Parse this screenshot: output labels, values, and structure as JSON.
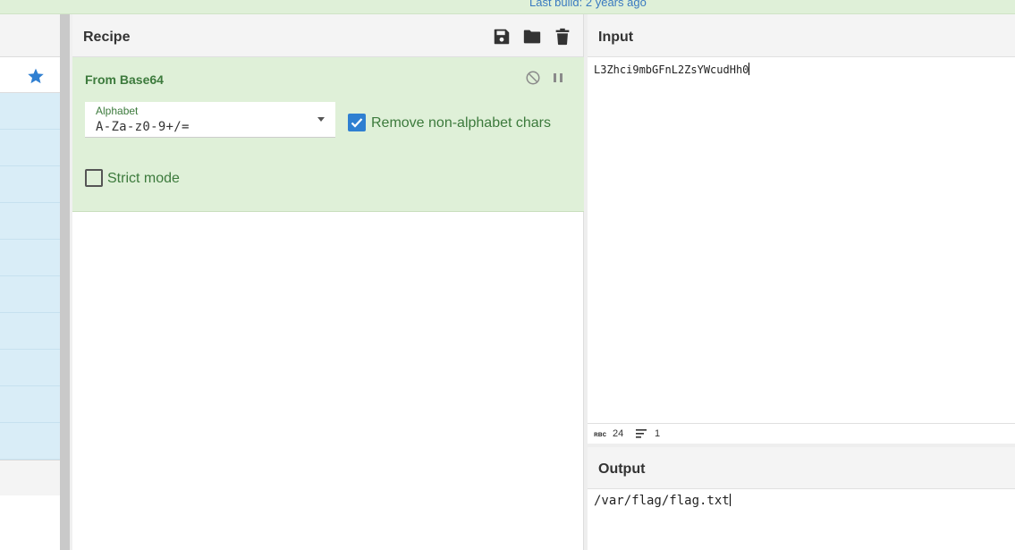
{
  "banner": {
    "text": "Last build: 2 years ago"
  },
  "colors": {
    "accent": "#2f7fd1",
    "op_bg": "#dff0d8",
    "op_text": "#3c7a3c",
    "ops_row": "#d9edf7"
  },
  "ops_pane": {
    "favourites_icon": "star-icon",
    "row_count": 10
  },
  "recipe": {
    "title": "Recipe",
    "icons": [
      "save-icon",
      "folder-icon",
      "trash-icon"
    ],
    "operation": {
      "name": "From Base64",
      "controls": [
        "disable-icon",
        "pause-icon"
      ],
      "alphabet": {
        "label": "Alphabet",
        "value": "A-Za-z0-9+/="
      },
      "remove_non_alphabet": {
        "label": "Remove non-alphabet chars",
        "checked": true
      },
      "strict_mode": {
        "label": "Strict mode",
        "checked": false
      }
    }
  },
  "input": {
    "title": "Input",
    "text": "L3Zhci9mbGFnL2ZsYWcudHh0",
    "status": {
      "length_icon": "abc-icon",
      "length": "24",
      "lines_icon": "lines-icon",
      "lines": "1"
    }
  },
  "output": {
    "title": "Output",
    "text": "/var/flag/flag.txt"
  }
}
